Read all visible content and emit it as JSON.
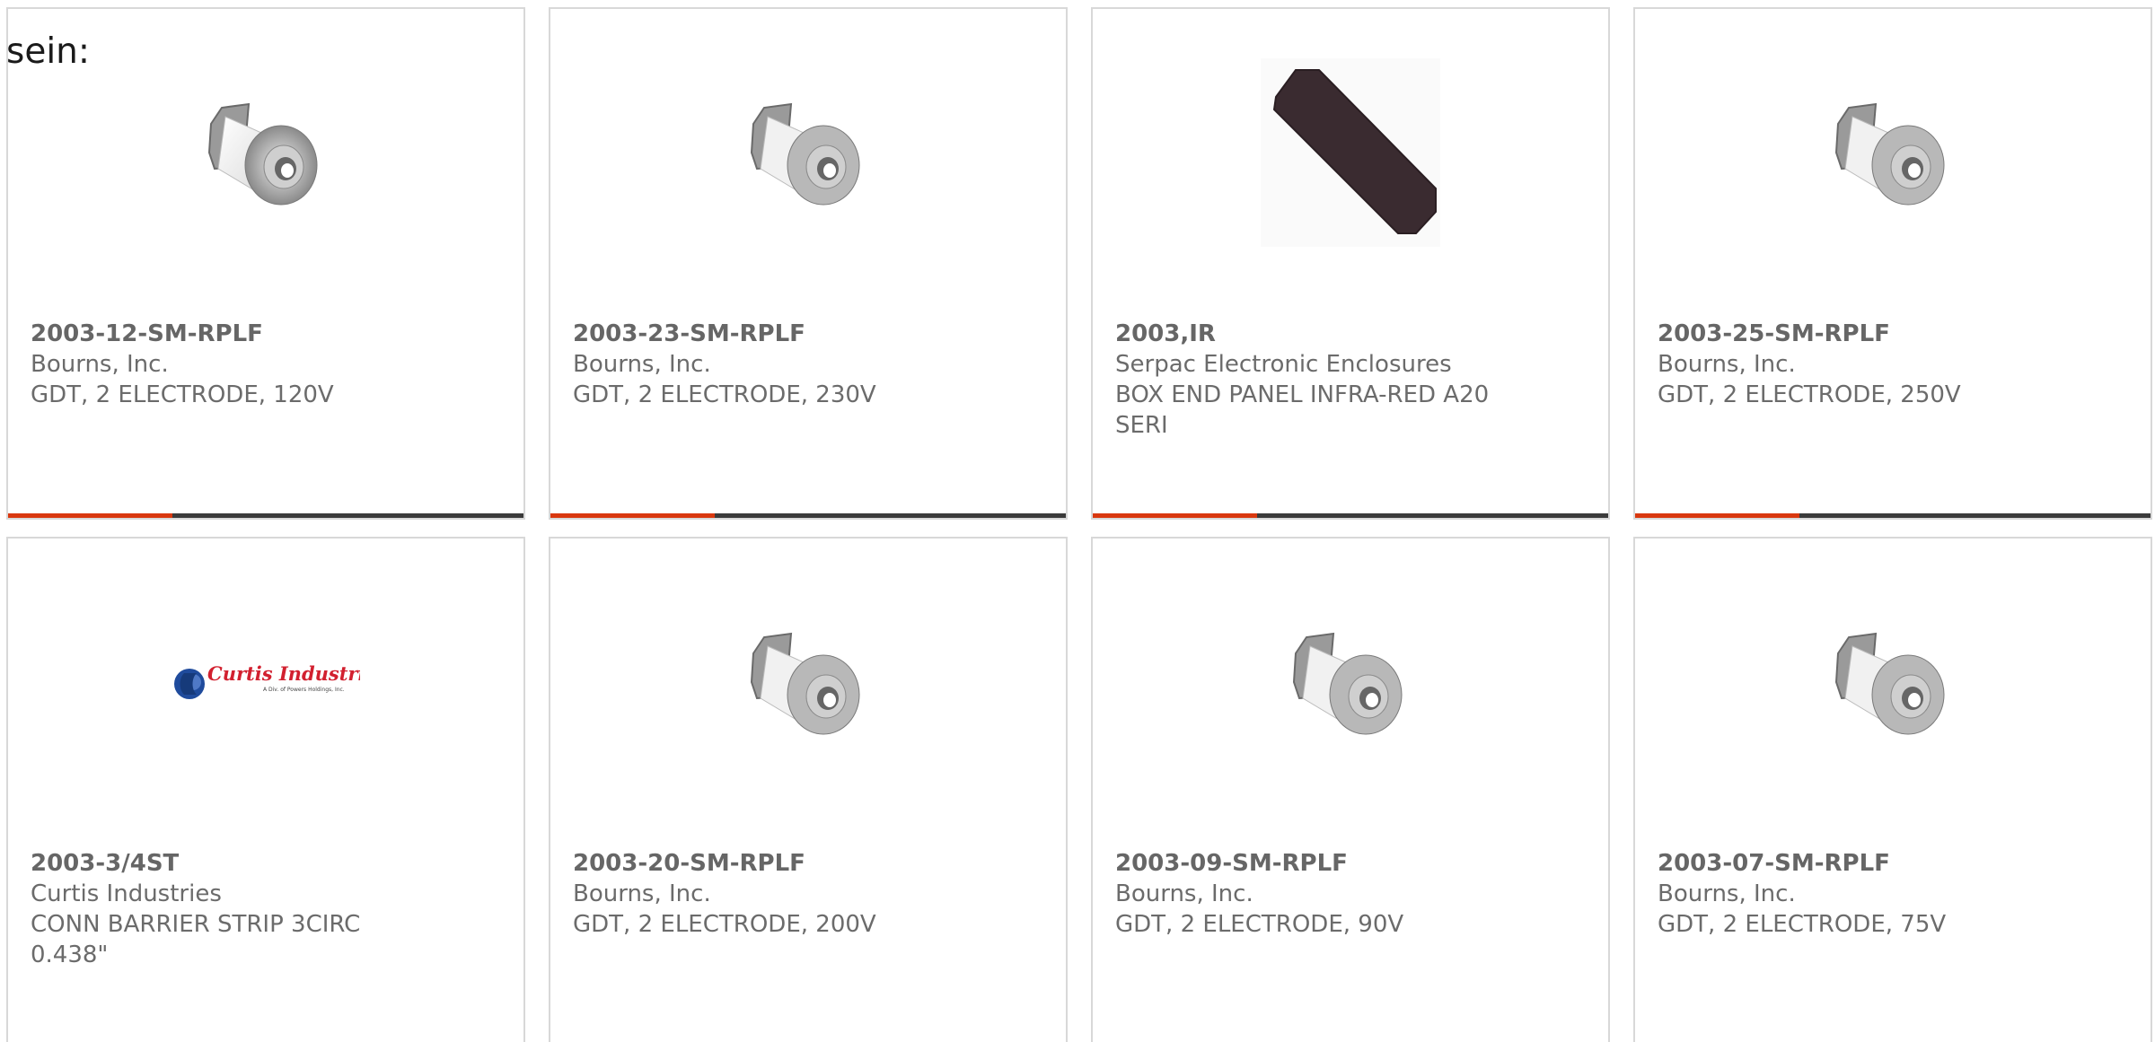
{
  "intro_text": "sein:",
  "products": [
    {
      "part": "2003-12-SM-RPLF",
      "maker": "Bourns, Inc.",
      "desc": "GDT, 2 ELECTRODE, 120V",
      "image": "gdt-cylinder"
    },
    {
      "part": "2003-23-SM-RPLF",
      "maker": "Bourns, Inc.",
      "desc": "GDT, 2 ELECTRODE, 230V",
      "image": "gdt-cylinder"
    },
    {
      "part": "2003,IR",
      "maker": "Serpac Electronic Enclosures",
      "desc": "BOX END PANEL INFRA-RED A20 SERI",
      "image": "panel"
    },
    {
      "part": "2003-25-SM-RPLF",
      "maker": "Bourns, Inc.",
      "desc": "GDT, 2 ELECTRODE, 250V",
      "image": "gdt-cylinder"
    },
    {
      "part": "2003-3/4ST",
      "maker": "Curtis Industries",
      "desc": "CONN BARRIER STRIP 3CIRC 0.438\"",
      "image": "curtis-logo",
      "logo_title": "Curtis Industries",
      "logo_sub": "A Div. of Powers Holdings, Inc."
    },
    {
      "part": "2003-20-SM-RPLF",
      "maker": "Bourns, Inc.",
      "desc": "GDT, 2 ELECTRODE, 200V",
      "image": "gdt-cylinder"
    },
    {
      "part": "2003-09-SM-RPLF",
      "maker": "Bourns, Inc.",
      "desc": "GDT, 2 ELECTRODE, 90V",
      "image": "gdt-cylinder"
    },
    {
      "part": "2003-07-SM-RPLF",
      "maker": "Bourns, Inc.",
      "desc": "GDT, 2 ELECTRODE, 75V",
      "image": "gdt-cylinder"
    }
  ],
  "colors": {
    "accent": "#d9380f",
    "bar": "#3b3b3b",
    "text": "#6b6b6b",
    "logo_red": "#d2202f",
    "logo_blue": "#1f4b9c"
  }
}
